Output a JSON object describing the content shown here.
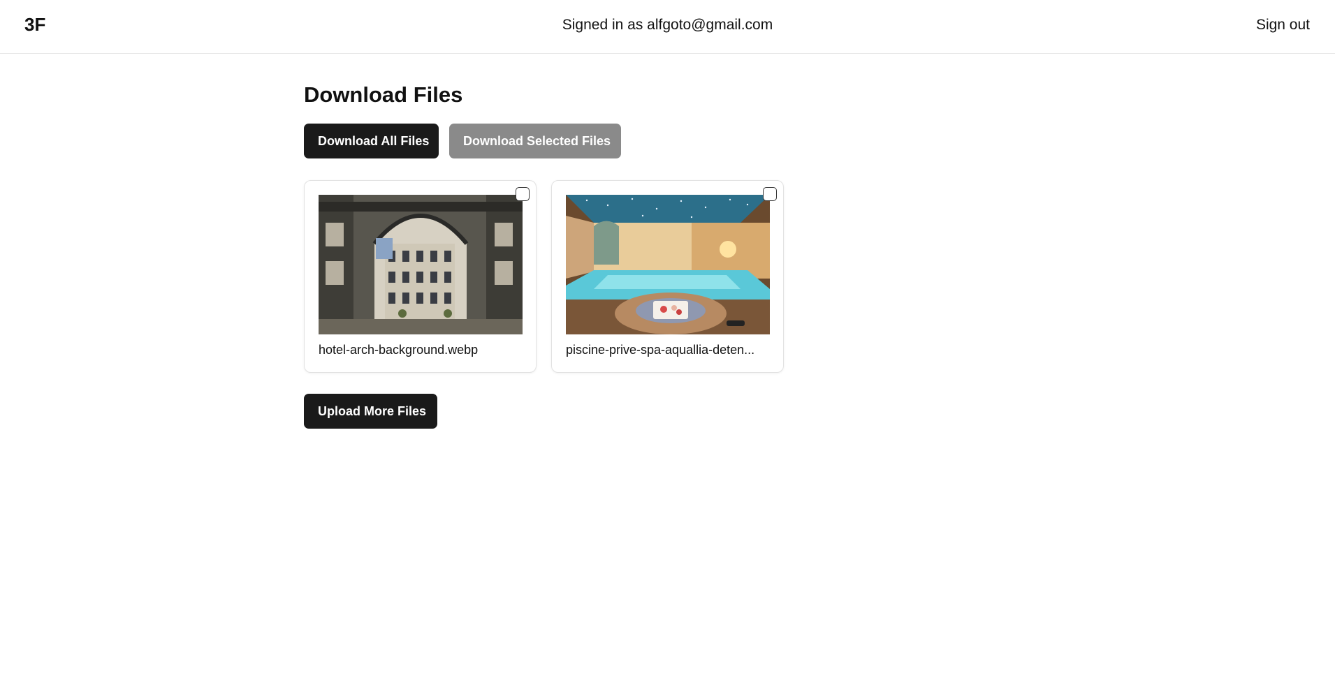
{
  "header": {
    "logo": "3F",
    "signed_in_text": "Signed in as alfgoto@gmail.com",
    "signout_label": "Sign out"
  },
  "main": {
    "title": "Download Files",
    "download_all_label": "Download All Files",
    "download_selected_label": "Download Selected Files",
    "upload_more_label": "Upload More Files"
  },
  "files": [
    {
      "name": "hotel-arch-background.webp",
      "checked": false
    },
    {
      "name": "piscine-prive-spa-aquallia-deten...",
      "checked": false
    }
  ],
  "colors": {
    "primary_button": "#1a1a1a",
    "disabled_button": "#8a8a8a",
    "divider": "#e6e6e6"
  }
}
